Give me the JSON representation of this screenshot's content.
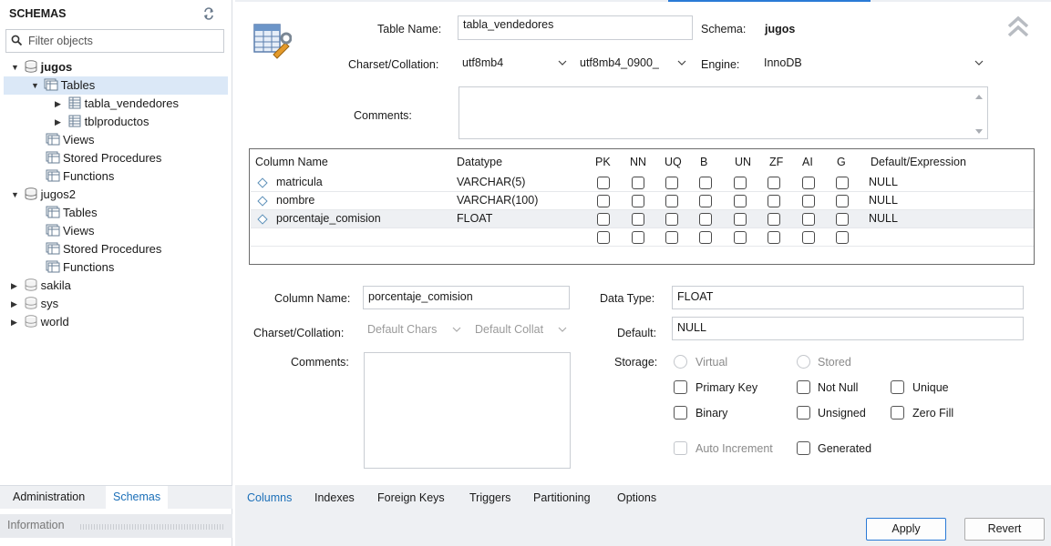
{
  "sidebar": {
    "title": "SCHEMAS",
    "filter_placeholder": "Filter objects",
    "tree": {
      "jugos": "jugos",
      "tables": "Tables",
      "tabla_vendedores": "tabla_vendedores",
      "tblproductos": "tblproductos",
      "views": "Views",
      "stored_procedures": "Stored Procedures",
      "functions": "Functions",
      "jugos2": "jugos2",
      "tables2": "Tables",
      "views2": "Views",
      "stored_procedures2": "Stored Procedures",
      "functions2": "Functions",
      "sakila": "sakila",
      "sys": "sys",
      "world": "world"
    },
    "tabs": {
      "administration": "Administration",
      "schemas": "Schemas"
    },
    "info_label": "Information"
  },
  "table_editor": {
    "table_name_label": "Table Name:",
    "table_name_value": "tabla_vendedores",
    "schema_label": "Schema:",
    "schema_value": "jugos",
    "charset_label": "Charset/Collation:",
    "charset_value": "utf8mb4",
    "collation_value": "utf8mb4_0900_",
    "engine_label": "Engine:",
    "engine_value": "InnoDB",
    "comments_label": "Comments:"
  },
  "grid": {
    "headers": {
      "column_name": "Column Name",
      "datatype": "Datatype",
      "pk": "PK",
      "nn": "NN",
      "uq": "UQ",
      "b": "B",
      "un": "UN",
      "zf": "ZF",
      "ai": "AI",
      "g": "G",
      "default": "Default/Expression"
    },
    "rows": [
      {
        "name": "matricula",
        "type": "VARCHAR(5)",
        "default": "NULL"
      },
      {
        "name": "nombre",
        "type": "VARCHAR(100)",
        "default": "NULL"
      },
      {
        "name": "porcentaje_comision",
        "type": "FLOAT",
        "default": "NULL"
      }
    ]
  },
  "column_details": {
    "column_name_label": "Column Name:",
    "column_name_value": "porcentaje_comision",
    "charset_label": "Charset/Collation:",
    "charset_value": "Default Chars",
    "collation_value": "Default Collat",
    "comments_label": "Comments:",
    "data_type_label": "Data Type:",
    "data_type_value": "FLOAT",
    "default_label": "Default:",
    "default_value": "NULL",
    "storage_label": "Storage:",
    "virtual": "Virtual",
    "stored": "Stored",
    "primary_key": "Primary Key",
    "not_null": "Not Null",
    "unique": "Unique",
    "binary": "Binary",
    "unsigned": "Unsigned",
    "zero_fill": "Zero Fill",
    "auto_increment": "Auto Increment",
    "generated": "Generated"
  },
  "bottom_tabs": {
    "columns": "Columns",
    "indexes": "Indexes",
    "foreign_keys": "Foreign Keys",
    "triggers": "Triggers",
    "partitioning": "Partitioning",
    "options": "Options"
  },
  "buttons": {
    "apply": "Apply",
    "revert": "Revert"
  },
  "colors": {
    "accent": "#1b6fb8",
    "selection": "#dbe8f7"
  }
}
